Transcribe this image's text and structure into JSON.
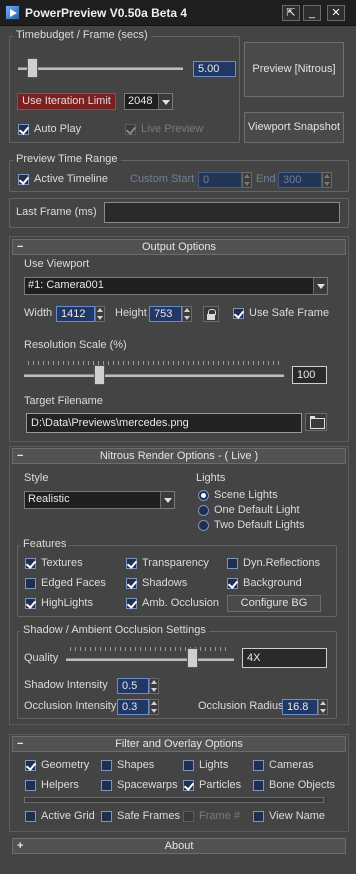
{
  "window": {
    "title": "PowerPreview V0.50a Beta 4"
  },
  "timebudget": {
    "group_label": "Timebudget / Frame (secs)",
    "value": "5.00",
    "slider_fraction": 0.07,
    "use_iteration_limit": "Use Iteration Limit",
    "iteration_value": "2048",
    "auto_play": "Auto Play",
    "live_preview": "Live Preview",
    "preview_button": "Preview [Nitrous]",
    "snapshot_button": "Viewport Snapshot"
  },
  "time_range": {
    "group_label": "Preview Time Range",
    "active_timeline": "Active Timeline",
    "custom_start": "Custom Start",
    "start_value": "0",
    "end_label": "End",
    "end_value": "300"
  },
  "last_frame": {
    "label": "Last Frame (ms)",
    "value": ""
  },
  "output_options": {
    "header": "Output Options",
    "sign": "−",
    "use_viewport": "Use Viewport",
    "viewport_value": "#1: Camera001",
    "width_label": "Width",
    "width_value": "1412",
    "height_label": "Height",
    "height_value": "753",
    "use_safe_frame": "Use Safe Frame",
    "res_scale_label": "Resolution Scale (%)",
    "res_scale_value": "100",
    "res_scale_fraction": 0.28,
    "target_label": "Target Filename",
    "target_value": "D:\\Data\\Previews\\mercedes.png"
  },
  "nitrous": {
    "header": "Nitrous Render Options - ( Live )",
    "sign": "−",
    "style_label": "Style",
    "style_value": "Realistic",
    "lights_label": "Lights",
    "lights": [
      "Scene Lights",
      "One Default Light",
      "Two Default Lights"
    ],
    "features_label": "Features",
    "features": {
      "textures": "Textures",
      "transparency": "Transparency",
      "dyn_reflections": "Dyn.Reflections",
      "edged_faces": "Edged Faces",
      "shadows": "Shadows",
      "background": "Background",
      "highlights": "HighLights",
      "amb_occlusion": "Amb. Occlusion",
      "configure_bg": "Configure BG"
    },
    "shadow_group_label": "Shadow / Ambient Occlusion Settings",
    "quality_label": "Quality",
    "quality_value": "4X",
    "quality_fraction": 0.77,
    "shadow_intensity_label": "Shadow Intensity",
    "shadow_intensity_value": "0.5",
    "occlusion_intensity_label": "Occlusion Intensity",
    "occlusion_intensity_value": "0.3",
    "occlusion_radius_label": "Occlusion Radius",
    "occlusion_radius_value": "16.8"
  },
  "filter": {
    "header": "Filter and Overlay Options",
    "sign": "−",
    "geometry": "Geometry",
    "shapes": "Shapes",
    "lights": "Lights",
    "cameras": "Cameras",
    "helpers": "Helpers",
    "spacewarps": "Spacewarps",
    "particles": "Particles",
    "bone_objects": "Bone Objects",
    "active_grid": "Active Grid",
    "safe_frames": "Safe Frames",
    "frame_num": "Frame #",
    "view_name": "View Name"
  },
  "about": {
    "header": "About",
    "sign": "+"
  }
}
